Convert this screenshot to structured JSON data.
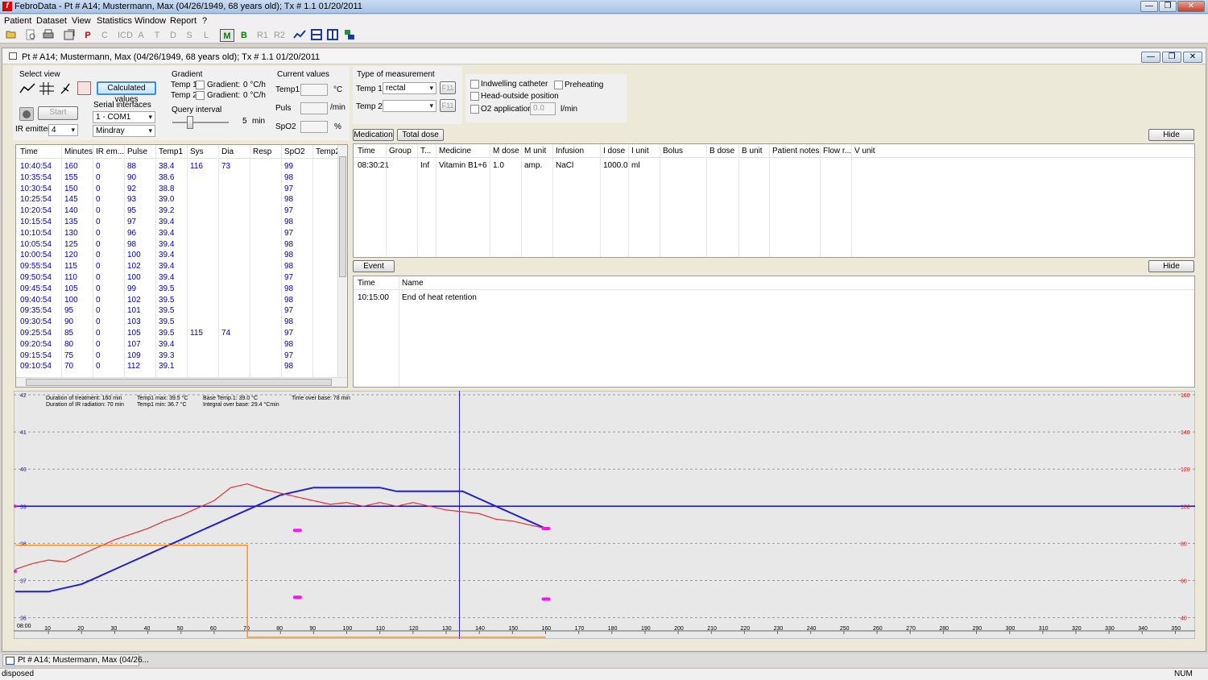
{
  "window": {
    "title": "FebroData - Pt # A14; Mustermann, Max (04/26/1949, 68 years old); Tx # 1.1   01/20/2011",
    "app_icon": "f",
    "minimize": "—",
    "restore": "❐",
    "close": "✕"
  },
  "menu": [
    "Patient",
    "Dataset",
    "View",
    "Statistics",
    "Window",
    "Report",
    "?"
  ],
  "toolbar": {
    "letters": [
      "P",
      "C",
      "ICD",
      "A",
      "T",
      "D",
      "S",
      "L",
      "M",
      "B",
      "R1",
      "R2"
    ],
    "colors": {
      "P": "#d00000",
      "M": "#0a7a0a",
      "B": "#0a7a0a"
    }
  },
  "child": {
    "title": "Pt # A14; Mustermann, Max (04/26/1949, 68 years old); Tx # 1.1   01/20/2011"
  },
  "select_view": {
    "label": "Select view",
    "calc_button": "Calculated values",
    "start_button": "Start",
    "ir_label": "IR emitters",
    "ir_value": "4"
  },
  "serial": {
    "label": "Serial interfaces",
    "port": "1 - COM1",
    "device": "Mindray"
  },
  "gradient": {
    "label": "Gradient",
    "rows": [
      {
        "name": "Temp 1",
        "glabel": "Gradient:",
        "value": "0 °C/h"
      },
      {
        "name": "Temp 2",
        "glabel": "Gradient:",
        "value": "0 °C/h"
      }
    ]
  },
  "query": {
    "label": "Query interval",
    "value": "5",
    "unit": "min"
  },
  "current": {
    "label": "Current values",
    "rows": [
      {
        "name": "Temp1",
        "unit": "°C"
      },
      {
        "name": "Puls",
        "unit": "/min"
      },
      {
        "name": "SpO2",
        "unit": "%"
      }
    ]
  },
  "measurement": {
    "label": "Type of measurement",
    "temp1_label": "Temp 1",
    "temp1_value": "rectal",
    "temp2_label": "Temp 2",
    "temp2_value": "",
    "f11": "F11"
  },
  "options": {
    "catheter": "Indwelling catheter",
    "preheating": "Preheating",
    "head": "Head-outside position",
    "o2": "O2 application",
    "o2_value": "0.0",
    "o2_unit": "l/min"
  },
  "vitals_table": {
    "headers": [
      "Time",
      "Minutes",
      "IR em...",
      "Pulse",
      "Temp1",
      "Sys",
      "Dia",
      "Resp",
      "SpO2",
      "Temp2"
    ],
    "rows": [
      [
        "10:40:54",
        "160",
        "0",
        "88",
        "38.4",
        "116",
        "73",
        "",
        "99"
      ],
      [
        "10:35:54",
        "155",
        "0",
        "90",
        "38.6",
        "",
        "",
        "",
        "98"
      ],
      [
        "10:30:54",
        "150",
        "0",
        "92",
        "38.8",
        "",
        "",
        "",
        "97"
      ],
      [
        "10:25:54",
        "145",
        "0",
        "93",
        "39.0",
        "",
        "",
        "",
        "98"
      ],
      [
        "10:20:54",
        "140",
        "0",
        "95",
        "39.2",
        "",
        "",
        "",
        "97"
      ],
      [
        "10:15:54",
        "135",
        "0",
        "97",
        "39.4",
        "",
        "",
        "",
        "98"
      ],
      [
        "10:10:54",
        "130",
        "0",
        "96",
        "39.4",
        "",
        "",
        "",
        "97"
      ],
      [
        "10:05:54",
        "125",
        "0",
        "98",
        "39.4",
        "",
        "",
        "",
        "98"
      ],
      [
        "10:00:54",
        "120",
        "0",
        "100",
        "39.4",
        "",
        "",
        "",
        "98"
      ],
      [
        "09:55:54",
        "115",
        "0",
        "102",
        "39.4",
        "",
        "",
        "",
        "98"
      ],
      [
        "09:50:54",
        "110",
        "0",
        "100",
        "39.4",
        "",
        "",
        "",
        "97"
      ],
      [
        "09:45:54",
        "105",
        "0",
        "99",
        "39.5",
        "",
        "",
        "",
        "98"
      ],
      [
        "09:40:54",
        "100",
        "0",
        "102",
        "39.5",
        "",
        "",
        "",
        "98"
      ],
      [
        "09:35:54",
        "95",
        "0",
        "101",
        "39.5",
        "",
        "",
        "",
        "97"
      ],
      [
        "09:30:54",
        "90",
        "0",
        "103",
        "39.5",
        "",
        "",
        "",
        "98"
      ],
      [
        "09:25:54",
        "85",
        "0",
        "105",
        "39.5",
        "115",
        "74",
        "",
        "97"
      ],
      [
        "09:20:54",
        "80",
        "0",
        "107",
        "39.4",
        "",
        "",
        "",
        "98"
      ],
      [
        "09:15:54",
        "75",
        "0",
        "109",
        "39.3",
        "",
        "",
        "",
        "97"
      ],
      [
        "09:10:54",
        "70",
        "0",
        "112",
        "39.1",
        "",
        "",
        "",
        "98"
      ]
    ]
  },
  "medication": {
    "tab1": "Medication",
    "tab2": "Total dose",
    "hide": "Hide",
    "headers": [
      "Time",
      "Group",
      "T...",
      "Medicine",
      "M dose",
      "M unit",
      "Infusion",
      "I dose",
      "I unit",
      "Bolus",
      "B dose",
      "B unit",
      "Patient notes",
      "Flow r...",
      "V unit"
    ],
    "rows": [
      [
        "08:30:21",
        "",
        "Inf",
        "Vitamin B1+6",
        "1.0",
        "amp.",
        "NaCl",
        "1000.0",
        "ml",
        "",
        "",
        "",
        "",
        "",
        ""
      ]
    ]
  },
  "events": {
    "tab": "Event",
    "hide": "Hide",
    "headers": [
      "Time",
      "Name"
    ],
    "rows": [
      [
        "10:15:00",
        "End of heat retention"
      ]
    ]
  },
  "chart_info": {
    "line1": "Duration of treatment: 160 min",
    "line2": "Duration of IR radiation: 70 min",
    "line3": "Temp1 max: 39.5 °C",
    "line4": "Temp1 min:  36.7 °C",
    "line5": "Base Temp.1:  39.0 °C",
    "line6": "Integral over base: 29.4 °Cmin",
    "line7": "Time over base: 78 min"
  },
  "chart_data": {
    "type": "line",
    "x_axis": {
      "range": [
        0,
        355
      ],
      "ticks": [
        10,
        20,
        30,
        40,
        50,
        60,
        70,
        80,
        90,
        100,
        110,
        120,
        130,
        140,
        150,
        160,
        170,
        180,
        190,
        200,
        210,
        220,
        230,
        240,
        250,
        260,
        270,
        280,
        290,
        300,
        310,
        320,
        330,
        340,
        350
      ],
      "start_label": "08:00"
    },
    "y_left": {
      "range": [
        35.6,
        42.0
      ],
      "ticks": [
        36.0,
        37.0,
        38.0,
        39.0,
        40.0,
        41.0,
        42.0
      ]
    },
    "y_right": {
      "range": [
        32,
        160
      ],
      "ticks": [
        40,
        60,
        80,
        100,
        120,
        140,
        160
      ]
    },
    "base_temp": 39.0,
    "cursor_x": 134,
    "series": [
      {
        "axis": "left",
        "color": "#2020d0",
        "x": [
          0,
          5,
          10,
          15,
          20,
          25,
          30,
          35,
          40,
          45,
          50,
          55,
          60,
          65,
          70,
          75,
          80,
          85,
          90,
          95,
          100,
          105,
          110,
          115,
          120,
          125,
          130,
          135,
          140,
          145,
          150,
          155,
          160
        ],
        "y": [
          36.7,
          36.7,
          36.7,
          36.8,
          36.9,
          37.1,
          37.3,
          37.5,
          37.7,
          37.9,
          38.1,
          38.3,
          38.5,
          38.7,
          38.9,
          39.1,
          39.3,
          39.4,
          39.5,
          39.5,
          39.5,
          39.5,
          39.5,
          39.4,
          39.4,
          39.4,
          39.4,
          39.4,
          39.2,
          39.0,
          38.8,
          38.6,
          38.4
        ]
      },
      {
        "axis": "right",
        "color": "#e03030",
        "x": [
          0,
          5,
          10,
          15,
          20,
          25,
          30,
          35,
          40,
          45,
          50,
          55,
          60,
          65,
          70,
          75,
          80,
          85,
          90,
          95,
          100,
          105,
          110,
          115,
          120,
          125,
          130,
          135,
          140,
          145,
          150,
          155,
          160
        ],
        "y": [
          66,
          69,
          71,
          70,
          74,
          78,
          82,
          85,
          88,
          92,
          95,
          99,
          103,
          110,
          112,
          109,
          107,
          105,
          103,
          101,
          102,
          100,
          102,
          100,
          102,
          100,
          98,
          97,
          96,
          93,
          92,
          90,
          88
        ]
      },
      {
        "axis": "right",
        "color": "#ff8000",
        "x": [
          0,
          70,
          70,
          160
        ],
        "y": [
          79,
          79,
          0,
          0
        ]
      }
    ],
    "markers": [
      {
        "x": 0,
        "y": 100,
        "axis": "right"
      },
      {
        "x": 0,
        "y": 65,
        "axis": "right"
      },
      {
        "x": 85,
        "y": 87,
        "axis": "right"
      },
      {
        "x": 85,
        "y": 51,
        "axis": "right"
      },
      {
        "x": 160,
        "y": 88,
        "axis": "right"
      },
      {
        "x": 160,
        "y": 50,
        "axis": "right"
      }
    ]
  },
  "taskbar": {
    "item": "Pt # A14; Mustermann, Max (04/26..."
  },
  "status": {
    "left": "disposed",
    "right": "NUM"
  }
}
